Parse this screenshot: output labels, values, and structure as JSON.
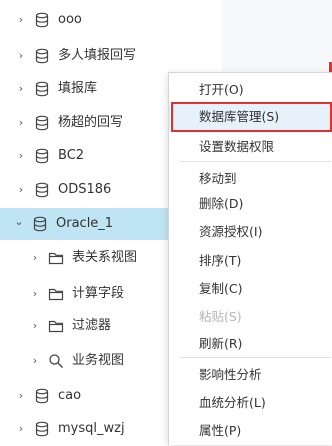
{
  "tree": {
    "items": [
      {
        "label": "ooo",
        "toggle": "›",
        "icon": "database-icon"
      },
      {
        "label": "多人填报回写",
        "toggle": "›",
        "icon": "database-icon"
      },
      {
        "label": "填报库",
        "toggle": "›",
        "icon": "database-icon"
      },
      {
        "label": "杨超的回写",
        "toggle": "›",
        "icon": "database-icon"
      },
      {
        "label": "BC2",
        "toggle": "›",
        "icon": "database-icon"
      },
      {
        "label": "ODS186",
        "toggle": "›",
        "icon": "database-icon"
      },
      {
        "label": "Oracle_1",
        "toggle": "⌄",
        "icon": "database-icon",
        "selected": true
      },
      {
        "label": "表关系视图",
        "toggle": "›",
        "icon": "folder-icon"
      },
      {
        "label": "计算字段",
        "toggle": "›",
        "icon": "folder-icon"
      },
      {
        "label": "过滤器",
        "toggle": "›",
        "icon": "folder-icon"
      },
      {
        "label": "业务视图",
        "toggle": "›",
        "icon": "search-icon"
      },
      {
        "label": "cao",
        "toggle": "›",
        "icon": "database-icon"
      },
      {
        "label": "mysql_wzj",
        "toggle": "›",
        "icon": "database-icon"
      }
    ]
  },
  "context_menu": {
    "items": [
      {
        "label": "打开(O)"
      },
      {
        "label": "数据库管理(S)",
        "highlighted": true
      },
      {
        "label": "设置数据权限"
      },
      {
        "label": "移动到"
      },
      {
        "label": "删除(D)"
      },
      {
        "label": "资源授权(I)"
      },
      {
        "label": "排序(T)"
      },
      {
        "label": "复制(C)"
      },
      {
        "label": "粘贴(S)",
        "disabled": true
      },
      {
        "label": "刷新(R)"
      },
      {
        "label": "影响性分析"
      },
      {
        "label": "血统分析(L)"
      },
      {
        "label": "属性(P)"
      }
    ]
  },
  "colors": {
    "selected_row": "#bfe4f4",
    "menu_highlight_border": "#e0312f",
    "menu_highlight_bg": "#e6f1fb",
    "disabled_text": "#b5b5b5"
  }
}
